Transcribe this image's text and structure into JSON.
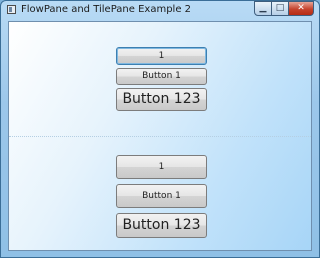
{
  "window": {
    "title": "FlowPane and TilePane Example 2",
    "caption_buttons": {
      "minimize": "▁",
      "maximize": "□",
      "close": "✕"
    }
  },
  "flowpane": {
    "buttons": [
      {
        "label": "1"
      },
      {
        "label": "Button 1"
      },
      {
        "label": "Button 123"
      }
    ]
  },
  "tilepane": {
    "buttons": [
      {
        "label": "1"
      },
      {
        "label": "Button 1"
      },
      {
        "label": "Button 123"
      }
    ]
  },
  "colors": {
    "focus": "#3c7fb1",
    "close_button": "#c5432d"
  },
  "icons": {
    "app": "window-icon"
  }
}
